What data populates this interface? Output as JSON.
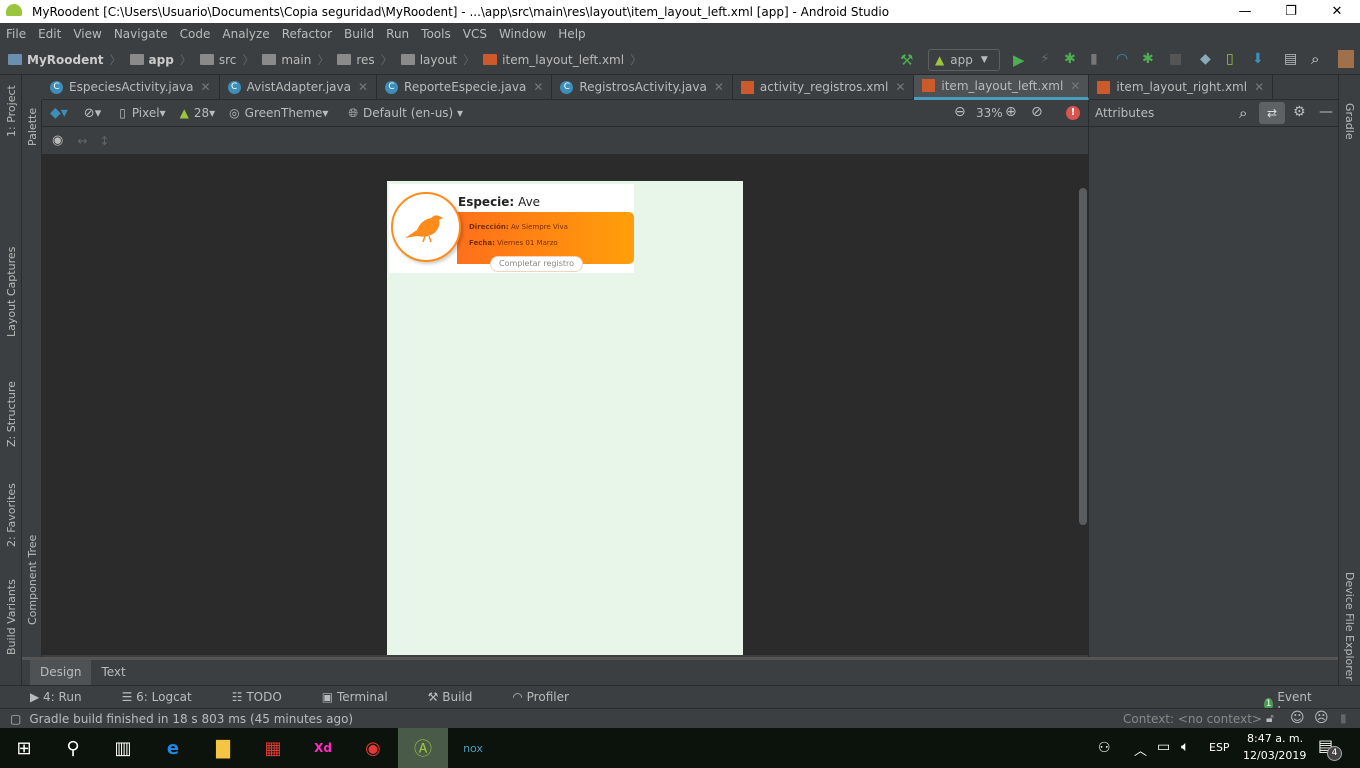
{
  "window": {
    "title": "MyRoodent [C:\\Users\\Usuario\\Documents\\Copia seguridad\\MyRoodent] - ...\\app\\src\\main\\res\\layout\\item_layout_left.xml [app] - Android Studio"
  },
  "menu": [
    "File",
    "Edit",
    "View",
    "Navigate",
    "Code",
    "Analyze",
    "Refactor",
    "Build",
    "Run",
    "Tools",
    "VCS",
    "Window",
    "Help"
  ],
  "breadcrumb": [
    "MyRoodent",
    "app",
    "src",
    "main",
    "res",
    "layout",
    "item_layout_left.xml"
  ],
  "run_config": "app",
  "tabs": [
    {
      "label": "EspeciesActivity.java",
      "type": "java"
    },
    {
      "label": "AvistAdapter.java",
      "type": "java"
    },
    {
      "label": "ReporteEspecie.java",
      "type": "java"
    },
    {
      "label": "RegistrosActivity.java",
      "type": "java"
    },
    {
      "label": "activity_registros.xml",
      "type": "xml"
    },
    {
      "label": "item_layout_left.xml",
      "type": "xml",
      "active": true
    },
    {
      "label": "item_layout_right.xml",
      "type": "xml"
    }
  ],
  "design_toolbar": {
    "device": "Pixel",
    "api": "28",
    "theme": "GreenTheme",
    "locale": "Default (en-us)",
    "zoom": "33%"
  },
  "attributes": {
    "title": "Attributes"
  },
  "left_tools": [
    "1: Project",
    "Palette",
    "Layout Captures",
    "Z: Structure",
    "2: Favorites",
    "Build Variants",
    "Component Tree"
  ],
  "right_tools": [
    "Gradle",
    "Device File Explorer"
  ],
  "card": {
    "species_label": "Especie:",
    "species_value": "Ave",
    "address_label": "Dirección:",
    "address_value": "Av Siempre Viva",
    "date_label": "Fecha:",
    "date_value": "Viernes 01 Marzo",
    "button": "Completar registro",
    "accent": "#ff8c1a"
  },
  "editor_tabs": [
    "Design",
    "Text"
  ],
  "tool_windows": [
    "4: Run",
    "6: Logcat",
    "TODO",
    "Terminal",
    "Build",
    "Profiler"
  ],
  "event_log": {
    "count": "1",
    "label": "Event Log"
  },
  "status": {
    "message": "Gradle build finished in 18 s 803 ms (45 minutes ago)",
    "context": "Context: <no context>"
  },
  "taskbar": {
    "lang": "ESP",
    "time": "8:47 a. m.",
    "date": "12/03/2019",
    "notifications": "4"
  }
}
